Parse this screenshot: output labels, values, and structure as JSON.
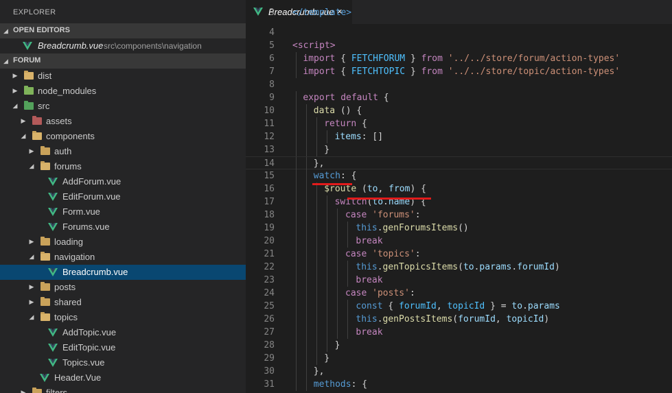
{
  "sidebar": {
    "title": "EXPLORER",
    "open_editors": {
      "label": "OPEN EDITORS",
      "items": [
        {
          "name": "Breadcrumb.vue",
          "path": "src\\components\\navigation"
        }
      ]
    },
    "project": {
      "label": "FORUM",
      "tree": [
        {
          "label": "dist",
          "depth": 0,
          "kind": "folder",
          "icon": "dist-folder-icon",
          "expanded": false
        },
        {
          "label": "node_modules",
          "depth": 0,
          "kind": "folder",
          "icon": "node-modules-folder-icon",
          "expanded": false
        },
        {
          "label": "src",
          "depth": 0,
          "kind": "folder",
          "icon": "src-folder-icon",
          "expanded": true
        },
        {
          "label": "assets",
          "depth": 1,
          "kind": "folder",
          "icon": "assets-folder-icon",
          "expanded": false
        },
        {
          "label": "components",
          "depth": 1,
          "kind": "folder",
          "icon": "folder-open-icon",
          "expanded": true
        },
        {
          "label": "auth",
          "depth": 2,
          "kind": "folder",
          "icon": "folder-icon",
          "expanded": false
        },
        {
          "label": "forums",
          "depth": 2,
          "kind": "folder",
          "icon": "folder-open-icon",
          "expanded": true
        },
        {
          "label": "AddForum.vue",
          "depth": 3,
          "kind": "file",
          "icon": "vue-file-icon"
        },
        {
          "label": "EditForum.vue",
          "depth": 3,
          "kind": "file",
          "icon": "vue-file-icon"
        },
        {
          "label": "Form.vue",
          "depth": 3,
          "kind": "file",
          "icon": "vue-file-icon"
        },
        {
          "label": "Forums.vue",
          "depth": 3,
          "kind": "file",
          "icon": "vue-file-icon"
        },
        {
          "label": "loading",
          "depth": 2,
          "kind": "folder",
          "icon": "folder-icon",
          "expanded": false
        },
        {
          "label": "navigation",
          "depth": 2,
          "kind": "folder",
          "icon": "folder-open-icon",
          "expanded": true
        },
        {
          "label": "Breadcrumb.vue",
          "depth": 3,
          "kind": "file",
          "icon": "vue-file-icon",
          "selected": true
        },
        {
          "label": "posts",
          "depth": 2,
          "kind": "folder",
          "icon": "folder-icon",
          "expanded": false
        },
        {
          "label": "shared",
          "depth": 2,
          "kind": "folder",
          "icon": "folder-icon",
          "expanded": false
        },
        {
          "label": "topics",
          "depth": 2,
          "kind": "folder",
          "icon": "folder-open-icon",
          "expanded": true
        },
        {
          "label": "AddTopic.vue",
          "depth": 3,
          "kind": "file",
          "icon": "vue-file-icon"
        },
        {
          "label": "EditTopic.vue",
          "depth": 3,
          "kind": "file",
          "icon": "vue-file-icon"
        },
        {
          "label": "Topics.vue",
          "depth": 3,
          "kind": "file",
          "icon": "vue-file-icon"
        },
        {
          "label": "Header.Vue",
          "depth": 2,
          "kind": "file",
          "icon": "vue-file-icon"
        },
        {
          "label": "filters",
          "depth": 1,
          "kind": "folder",
          "icon": "folder-icon",
          "expanded": false
        }
      ]
    }
  },
  "editor": {
    "tab": {
      "label": "Breadcrumb.vue",
      "close_glyph": "×"
    },
    "first_line": 4,
    "lines": [
      [],
      [
        [
          "tag",
          "<script>"
        ]
      ],
      [
        [
          "kw",
          "import"
        ],
        [
          "txt",
          " { "
        ],
        [
          "cls",
          "FETCHFORUM"
        ],
        [
          "txt",
          " } "
        ],
        [
          "kw",
          "from"
        ],
        [
          "txt",
          " "
        ],
        [
          "str",
          "'../../store/forum/action-types'"
        ]
      ],
      [
        [
          "kw",
          "import"
        ],
        [
          "txt",
          " { "
        ],
        [
          "cls",
          "FETCHTOPIC"
        ],
        [
          "txt",
          " } "
        ],
        [
          "kw",
          "from"
        ],
        [
          "txt",
          " "
        ],
        [
          "str",
          "'../../store/topic/action-types'"
        ]
      ],
      [],
      [
        [
          "kw",
          "export"
        ],
        [
          "txt",
          " "
        ],
        [
          "kw",
          "default"
        ],
        [
          "txt",
          " {"
        ]
      ],
      [
        [
          "fn",
          "data"
        ],
        [
          "txt",
          " () {"
        ]
      ],
      [
        [
          "kw",
          "return"
        ],
        [
          "txt",
          " {"
        ]
      ],
      [
        [
          "var",
          "items"
        ],
        [
          "txt",
          ": []"
        ]
      ],
      [
        [
          "txt",
          "}"
        ]
      ],
      [
        [
          "txt",
          "},"
        ]
      ],
      [
        [
          "prop",
          "watch"
        ],
        [
          "txt",
          ": {"
        ]
      ],
      [
        [
          "fn",
          "$route"
        ],
        [
          "txt",
          " ("
        ],
        [
          "var",
          "to"
        ],
        [
          "txt",
          ", "
        ],
        [
          "var",
          "from"
        ],
        [
          "txt",
          ") {"
        ]
      ],
      [
        [
          "kw",
          "switch"
        ],
        [
          "txt",
          "("
        ],
        [
          "var",
          "to"
        ],
        [
          "txt",
          "."
        ],
        [
          "var",
          "name"
        ],
        [
          "txt",
          ") {"
        ]
      ],
      [
        [
          "kw",
          "case"
        ],
        [
          "txt",
          " "
        ],
        [
          "str",
          "'forums'"
        ],
        [
          "txt",
          ":"
        ]
      ],
      [
        [
          "prop",
          "this"
        ],
        [
          "txt",
          "."
        ],
        [
          "fn",
          "genForumsItems"
        ],
        [
          "txt",
          "()"
        ]
      ],
      [
        [
          "kw",
          "break"
        ]
      ],
      [
        [
          "kw",
          "case"
        ],
        [
          "txt",
          " "
        ],
        [
          "str",
          "'topics'"
        ],
        [
          "txt",
          ":"
        ]
      ],
      [
        [
          "prop",
          "this"
        ],
        [
          "txt",
          "."
        ],
        [
          "fn",
          "genTopicsItems"
        ],
        [
          "txt",
          "("
        ],
        [
          "var",
          "to"
        ],
        [
          "txt",
          "."
        ],
        [
          "var",
          "params"
        ],
        [
          "txt",
          "."
        ],
        [
          "var",
          "forumId"
        ],
        [
          "txt",
          ")"
        ]
      ],
      [
        [
          "kw",
          "break"
        ]
      ],
      [
        [
          "kw",
          "case"
        ],
        [
          "txt",
          " "
        ],
        [
          "str",
          "'posts'"
        ],
        [
          "txt",
          ":"
        ]
      ],
      [
        [
          "prop",
          "const"
        ],
        [
          "txt",
          " { "
        ],
        [
          "cls",
          "forumId"
        ],
        [
          "txt",
          ", "
        ],
        [
          "cls",
          "topicId"
        ],
        [
          "txt",
          " } = "
        ],
        [
          "var",
          "to"
        ],
        [
          "txt",
          "."
        ],
        [
          "var",
          "params"
        ]
      ],
      [
        [
          "prop",
          "this"
        ],
        [
          "txt",
          "."
        ],
        [
          "fn",
          "genPostsItems"
        ],
        [
          "txt",
          "("
        ],
        [
          "var",
          "forumId"
        ],
        [
          "txt",
          ", "
        ],
        [
          "var",
          "topicId"
        ],
        [
          "txt",
          ")"
        ]
      ],
      [
        [
          "kw",
          "break"
        ]
      ],
      [
        [
          "txt",
          "}"
        ]
      ],
      [
        [
          "txt",
          "}"
        ]
      ],
      [
        [
          "txt",
          "},"
        ]
      ],
      [
        [
          "prop",
          "methods"
        ],
        [
          "txt",
          ": {"
        ]
      ]
    ],
    "top_partial": [
      [
        "comment",
        "</template>"
      ]
    ],
    "colors": {
      "tag": "#c586c0",
      "keyword": "#c586c0",
      "string": "#ce9178",
      "function": "#dcdcaa",
      "variable": "#9cdcfe",
      "annotation": "#e21b1b"
    }
  }
}
